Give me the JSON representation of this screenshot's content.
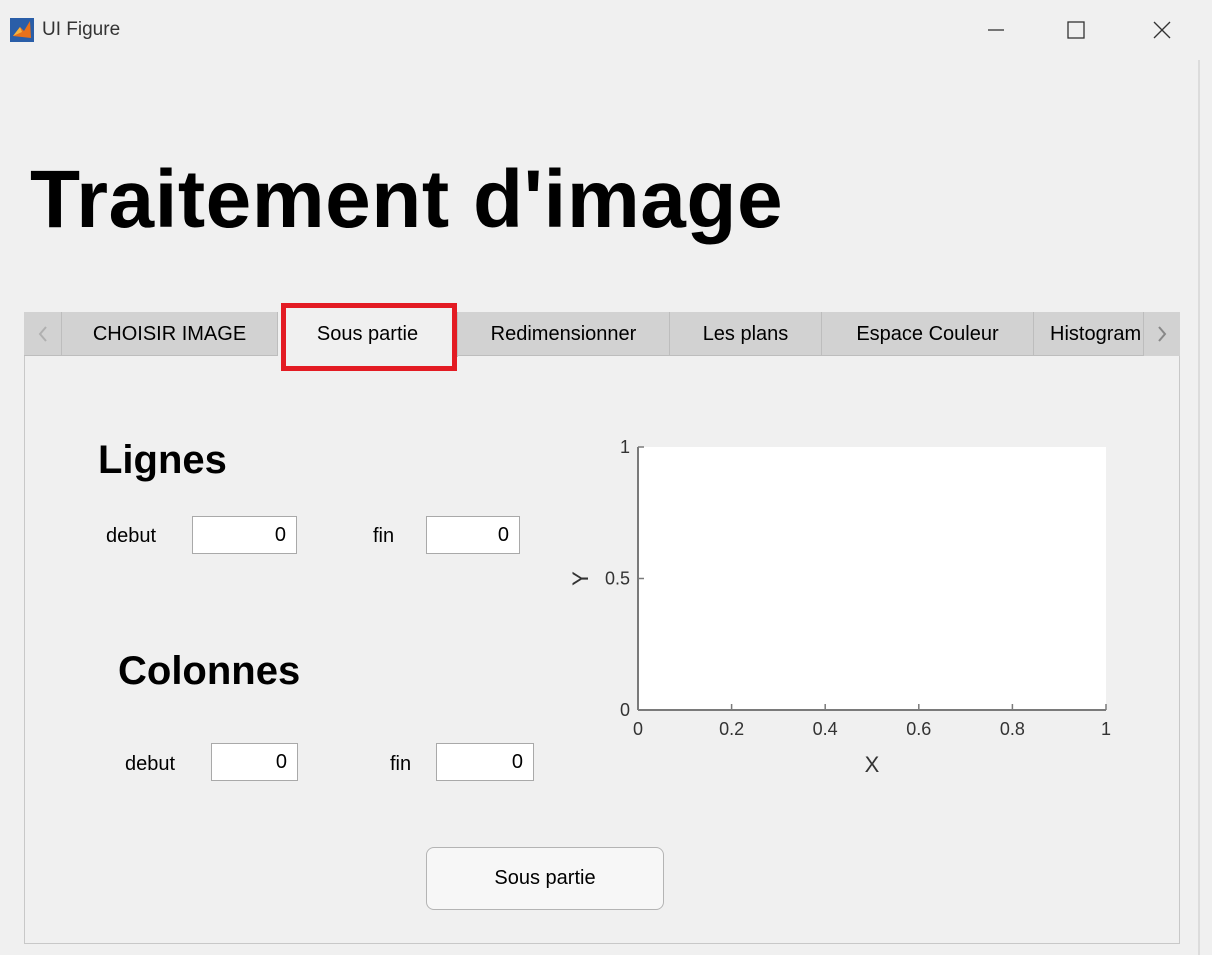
{
  "window": {
    "title": "UI Figure",
    "icon": "matlab-icon"
  },
  "heading": "Traitement d'image",
  "tabs": [
    {
      "label": "CHOISIR IMAGE",
      "active": false
    },
    {
      "label": "Sous partie",
      "active": true
    },
    {
      "label": "Redimensionner",
      "active": false
    },
    {
      "label": "Les plans",
      "active": false
    },
    {
      "label": "Espace Couleur",
      "active": false
    },
    {
      "label": "Histogram",
      "active": false
    }
  ],
  "lignes": {
    "title": "Lignes",
    "debut_label": "debut",
    "debut_value": "0",
    "fin_label": "fin",
    "fin_value": "0"
  },
  "colonnes": {
    "title": "Colonnes",
    "debut_label": "debut",
    "debut_value": "0",
    "fin_label": "fin",
    "fin_value": "0"
  },
  "button": {
    "label": "Sous partie"
  },
  "chart_data": {
    "type": "scatter",
    "title": "",
    "xlabel": "X",
    "ylabel": "Y",
    "xlim": [
      0,
      1
    ],
    "ylim": [
      0,
      1
    ],
    "xticks": [
      0,
      0.2,
      0.4,
      0.6,
      0.8,
      1
    ],
    "yticks": [
      0,
      0.5,
      1
    ],
    "series": []
  },
  "colors": {
    "highlight": "#e31b23",
    "tabbar": "#d2d2d2",
    "background": "#f0f0f0"
  }
}
